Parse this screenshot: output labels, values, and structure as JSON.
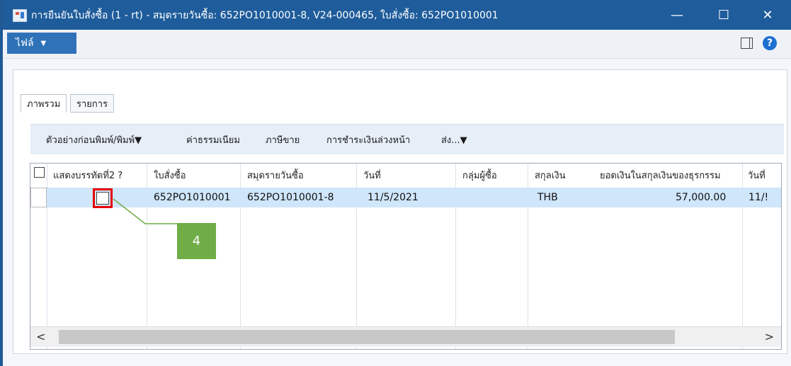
{
  "window": {
    "title": "การยืนยันใบสั่งซื้อ (1 - rt) - สมุดรายวันซื้อ: 652PO1010001-8, V24-000465, ใบสั่งซื้อ: 652PO1010001",
    "minimize_glyph": "—",
    "maximize_glyph": "☐",
    "close_glyph": "✕"
  },
  "menu": {
    "file_label": "ไฟล์",
    "file_caret": "▼",
    "help_glyph": "?"
  },
  "tabs": [
    {
      "label": "ภาพรวม",
      "active": true
    },
    {
      "label": "รายการ",
      "active": false
    }
  ],
  "toolbar": [
    {
      "label": "ตัวอย่างก่อนพิมพ์/พิมพ์▼"
    },
    {
      "label": "ค่าธรรมเนียม"
    },
    {
      "label": "ภาษีขาย"
    },
    {
      "label": "การชำระเงินล่วงหน้า"
    },
    {
      "label": "ส่ง...▼"
    }
  ],
  "grid": {
    "columns": [
      {
        "label": "แสดงบรรทัดที่2 ?"
      },
      {
        "label": "ใบสั่งซื้อ"
      },
      {
        "label": "สมุดรายวันซื้อ"
      },
      {
        "label": "วันที่"
      },
      {
        "label": "กลุ่มผู้ซื้อ"
      },
      {
        "label": "สกุลเงิน"
      },
      {
        "label": "ยอดเงินในสกุลเงินของธุรกรรม"
      },
      {
        "label": "วันที่"
      }
    ],
    "rows": [
      {
        "show_line2_checked": false,
        "purchase_order": "652PO1010001",
        "journal": "652PO1010001-8",
        "date": "11/5/2021",
        "buyer_group": "",
        "currency": "THB",
        "amount": "57,000.00",
        "date2": "11/!"
      }
    ]
  },
  "scroll": {
    "left": "<",
    "right": ">"
  },
  "annotation": {
    "callout_number": "4",
    "callout_color": "#70ad47",
    "highlight_color": "#e60000"
  },
  "colors": {
    "titlebar": "#1e5c9b",
    "file_button": "#2f72b8",
    "selected_row": "#cfe6fb",
    "toolbar": "#e6eef8"
  }
}
